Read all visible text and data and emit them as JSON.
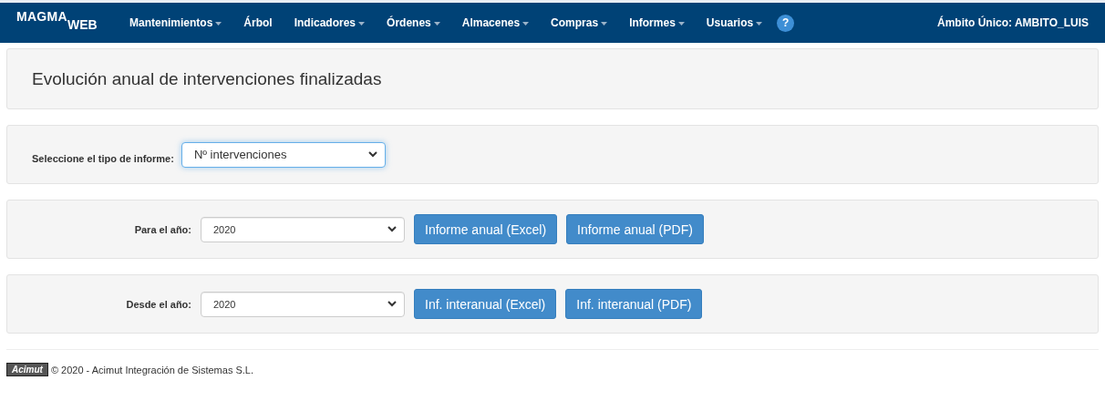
{
  "navbar": {
    "logo": {
      "main": "MAGMA",
      "sub": "WEB"
    },
    "menu": [
      {
        "label": "Mantenimientos",
        "dropdown": true
      },
      {
        "label": "Árbol",
        "dropdown": false
      },
      {
        "label": "Indicadores",
        "dropdown": true
      },
      {
        "label": "Órdenes",
        "dropdown": true
      },
      {
        "label": "Almacenes",
        "dropdown": true
      },
      {
        "label": "Compras",
        "dropdown": true
      },
      {
        "label": "Informes",
        "dropdown": true
      },
      {
        "label": "Usuarios",
        "dropdown": true
      }
    ],
    "help": "?",
    "scope": "Ámbito Único: AMBITO_LUIS"
  },
  "page_title": "Evolución anual de intervenciones finalizadas",
  "report_type": {
    "label": "Seleccione el tipo de informe:",
    "value": "Nº intervenciones",
    "focused": true
  },
  "year_rows": [
    {
      "label": "Para el año:",
      "value": "2020",
      "focused": false,
      "buttons": [
        "Informe anual (Excel)",
        "Informe anual (PDF)"
      ]
    },
    {
      "label": "Desde el año:",
      "value": "2020",
      "focused": false,
      "buttons": [
        "Inf. interanual (Excel)",
        "Inf. interanual (PDF)"
      ]
    }
  ],
  "footer": {
    "logo": "Acimut",
    "text": "© 2020 - Acimut Integración de Sistemas S.L."
  }
}
